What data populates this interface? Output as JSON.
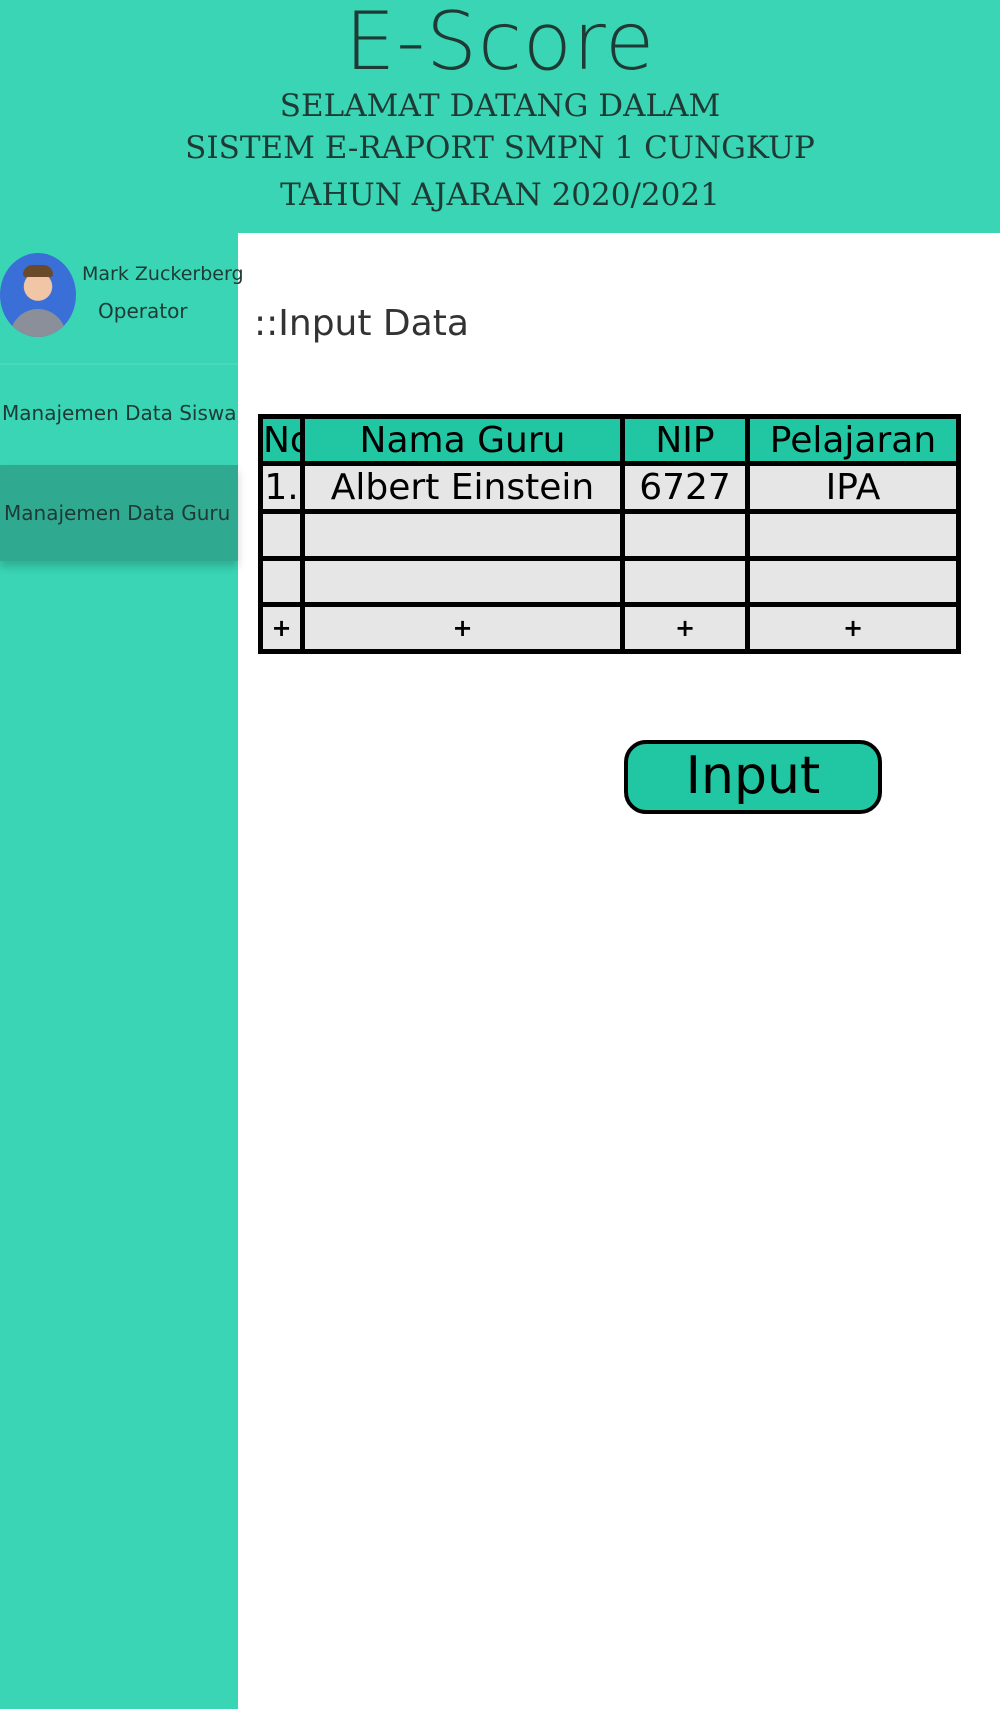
{
  "header": {
    "app_title": "E-Score",
    "subtitle_line1": "SELAMAT DATANG DALAM",
    "subtitle_line2": "SISTEM E-RAPORT SMPN 1 CUNGKUP",
    "subtitle_line3": "TAHUN AJARAN  2020/2021"
  },
  "sidebar": {
    "user": {
      "name": "Mark Zuckerberg",
      "role": "Operator"
    },
    "items": [
      {
        "label": "Manajemen Data Siswa",
        "active": false
      },
      {
        "label": "Manajemen Data Guru",
        "active": true
      }
    ]
  },
  "main": {
    "section_title": "::Input Data",
    "table": {
      "headers": [
        "No",
        "Nama Guru",
        "NIP",
        "Pelajaran"
      ],
      "rows": [
        [
          "1.",
          "Albert Einstein",
          "6727",
          "IPA"
        ],
        [
          "",
          "",
          "",
          ""
        ],
        [
          "",
          "",
          "",
          ""
        ]
      ],
      "add_row": [
        "+",
        "+",
        "+",
        "+"
      ]
    },
    "input_button": "Input"
  },
  "colors": {
    "accent": "#39d5b5",
    "header_cell": "#21c6a3",
    "active_menu": "#2fa98f",
    "cell_bg": "#e6e6e6"
  }
}
